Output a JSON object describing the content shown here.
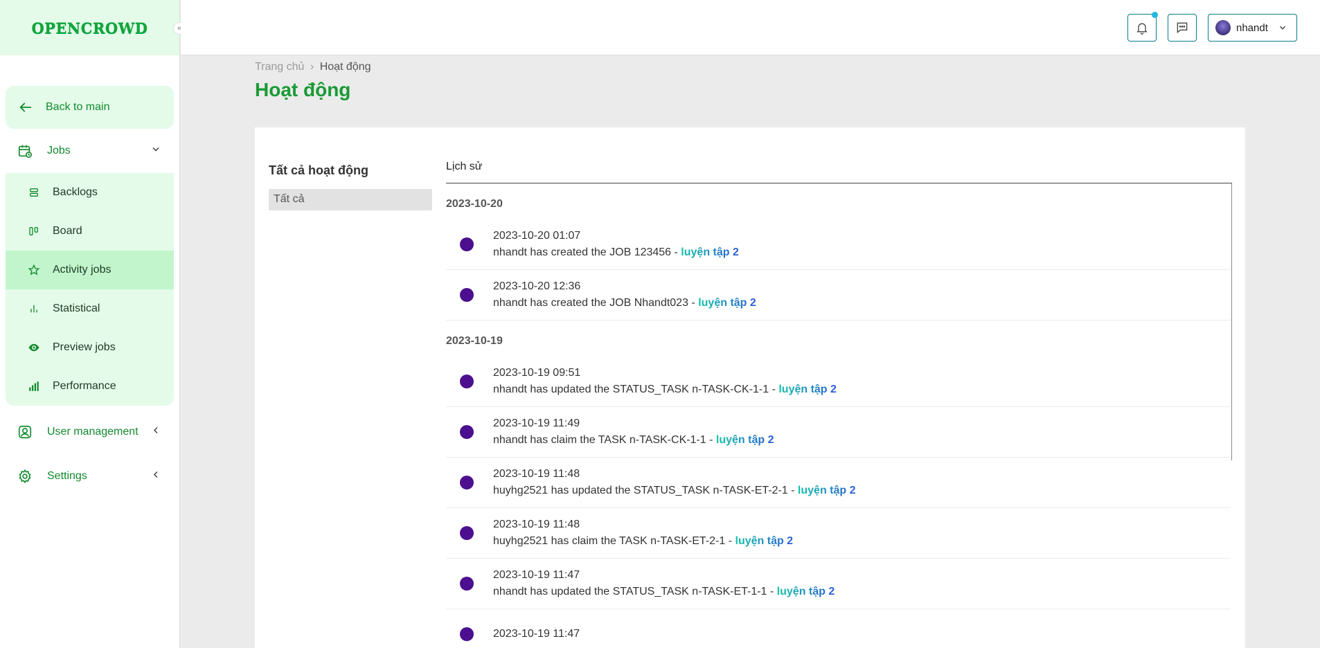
{
  "app": {
    "logo": "OPENCROWD",
    "collapse_glyph": "«"
  },
  "sidebar": {
    "back_label": "Back to main",
    "jobs_label": "Jobs",
    "jobs_items": [
      {
        "label": "Backlogs",
        "icon": "backlogs-icon"
      },
      {
        "label": "Board",
        "icon": "board-icon"
      },
      {
        "label": "Activity jobs",
        "icon": "activity-icon",
        "active": true
      },
      {
        "label": "Statistical",
        "icon": "statistical-icon"
      },
      {
        "label": "Preview jobs",
        "icon": "eye-icon"
      },
      {
        "label": "Performance",
        "icon": "performance-icon"
      }
    ],
    "user_management_label": "User management",
    "settings_label": "Settings"
  },
  "header": {
    "username": "nhandt"
  },
  "breadcrumb": {
    "home": "Trang chủ",
    "separator": "›",
    "current": "Hoạt động"
  },
  "page": {
    "title": "Hoạt động"
  },
  "filter": {
    "title": "Tất cả hoạt động",
    "option": "Tất cả"
  },
  "history": {
    "tab_label": "Lịch sử",
    "groups": [
      {
        "date": "2023-10-20",
        "entries": [
          {
            "time": "2023-10-20 01:07",
            "text": "nhandt has created the JOB 123456 - ",
            "link": "luyện tập 2"
          },
          {
            "time": "2023-10-20 12:36",
            "text": "nhandt has created the JOB Nhandt023 - ",
            "link": "luyện tập 2"
          }
        ]
      },
      {
        "date": "2023-10-19",
        "entries": [
          {
            "time": "2023-10-19 09:51",
            "text": "nhandt has updated the STATUS_TASK n-TASK-CK-1-1 - ",
            "link": "luyện tập 2"
          },
          {
            "time": "2023-10-19 11:49",
            "text": "nhandt has claim the TASK n-TASK-CK-1-1 - ",
            "link": "luyện tập 2"
          },
          {
            "time": "2023-10-19 11:48",
            "text": "huyhg2521 has updated the STATUS_TASK n-TASK-ET-2-1 - ",
            "link": "luyện tập 2"
          },
          {
            "time": "2023-10-19 11:48",
            "text": "huyhg2521 has claim the TASK n-TASK-ET-2-1 - ",
            "link": "luyện tập 2"
          },
          {
            "time": "2023-10-19 11:47",
            "text": "nhandt has updated the STATUS_TASK n-TASK-ET-1-1 - ",
            "link": "luyện tập 2"
          },
          {
            "time": "2023-10-19 11:47",
            "text": "",
            "link": ""
          }
        ]
      }
    ]
  },
  "colors": {
    "brand_green": "#1a9a36",
    "bullet": "#4b0f8f",
    "header_border": "#0a7c8a"
  }
}
